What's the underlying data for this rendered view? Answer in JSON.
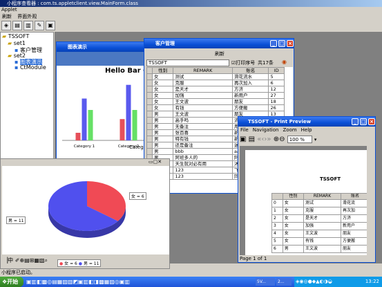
{
  "app": {
    "title": "小程序查看器 : com.ts.appletclient.view.MainForm.class",
    "applet_label": "Applet",
    "menu": [
      "刷新",
      "界面外观"
    ],
    "status": "小程序已启动。"
  },
  "tree": {
    "root": "TSSOFT",
    "set1": "set1",
    "set1_child": "客户管理",
    "set2": "set2",
    "set2_child1": "图表演示",
    "set2_child2": "CtModule"
  },
  "chart_window": {
    "title": "图表演示",
    "chart_title": "Hello Bar Ch",
    "axis_label": "Categor"
  },
  "chart_data": {
    "type": "bar",
    "title": "Hello Bar Ch",
    "categories": [
      "Category 1",
      "Category 2",
      "Category 3"
    ],
    "series": [
      {
        "color": "#e6505a",
        "values": [
          0.1,
          0.28,
          0.28
        ]
      },
      {
        "color": "#5a5aee",
        "values": [
          0.55,
          0.73,
          0.57
        ]
      },
      {
        "color": "#66e066",
        "values": [
          0.4,
          0.4,
          0.4
        ]
      }
    ],
    "ylim": [
      0,
      0.8
    ],
    "xlabel": "Categor"
  },
  "pie_chart": {
    "type": "pie",
    "slices": [
      {
        "label": "女 = 6",
        "value": 6,
        "color": "#f04a55"
      },
      {
        "label": "男 = 11",
        "value": 11,
        "color": "#5050ee"
      }
    ],
    "legend": [
      {
        "label": "女 = 6",
        "color": "#f04a55"
      },
      {
        "label": "男 = 11",
        "color": "#5050ee"
      }
    ]
  },
  "customer_window": {
    "title": "客户管理",
    "refresh_label": "刷新",
    "filter_value": "TSSOFT",
    "print_seq_label": "打印序号",
    "total_label": "共17条",
    "headers": [
      "性别",
      "REMARK",
      "账名",
      "ID"
    ],
    "rows": [
      [
        "女",
        "测试",
        "滑花流水",
        "5"
      ],
      [
        "女",
        "克服",
        "再次加入",
        "6"
      ],
      [
        "女",
        "是天才",
        "方济",
        "12"
      ],
      [
        "女",
        "加强",
        "新用户",
        "27"
      ],
      [
        "女",
        "王文波",
        "朋友",
        "18"
      ],
      [
        "女",
        "有钱",
        "方便搬",
        "26"
      ],
      [
        "男",
        "王文波",
        "朋友",
        "13"
      ],
      [
        "男",
        "高手吗",
        "流水",
        ""
      ],
      [
        "男",
        "无备注",
        "用户",
        ""
      ],
      [
        "男",
        "张百喜",
        "新用户",
        ""
      ],
      [
        "男",
        "特有钱",
        "新客户",
        ""
      ],
      [
        "男",
        "还是备注",
        "迷宇",
        ""
      ],
      [
        "男",
        "bbb",
        "aaa",
        ""
      ],
      [
        "男",
        "阿班多人的",
        "阿班",
        ""
      ],
      [
        "女",
        "天生就对必有用",
        "沐浪",
        ""
      ],
      [
        "男",
        "123",
        "飞鱼",
        ""
      ],
      [
        "男",
        "123",
        "同志",
        ""
      ]
    ]
  },
  "print_preview": {
    "title": "TSSOFT - Print Preview",
    "menu": [
      "File",
      "Navigation",
      "Zoom",
      "Help"
    ],
    "zoom": "100 %",
    "doc_title": "TSSOFT",
    "headers": [
      "",
      "性别",
      "REMARK",
      "账名"
    ],
    "rows": [
      [
        "0",
        "女",
        "测试",
        "滑花流"
      ],
      [
        "1",
        "女",
        "克服",
        "再次加"
      ],
      [
        "2",
        "女",
        "是天才",
        "方济"
      ],
      [
        "3",
        "女",
        "加强",
        "新用户"
      ],
      [
        "4",
        "女",
        "王文波",
        "朋友"
      ],
      [
        "5",
        "女",
        "有钱",
        "方便搬"
      ],
      [
        "6",
        "男",
        "王文波",
        "朋友"
      ]
    ],
    "status": "Page 1 of 1"
  },
  "taskbar": {
    "start_label": "开始",
    "tasks": [
      "5V...",
      "2..."
    ],
    "clock": "13:22"
  }
}
